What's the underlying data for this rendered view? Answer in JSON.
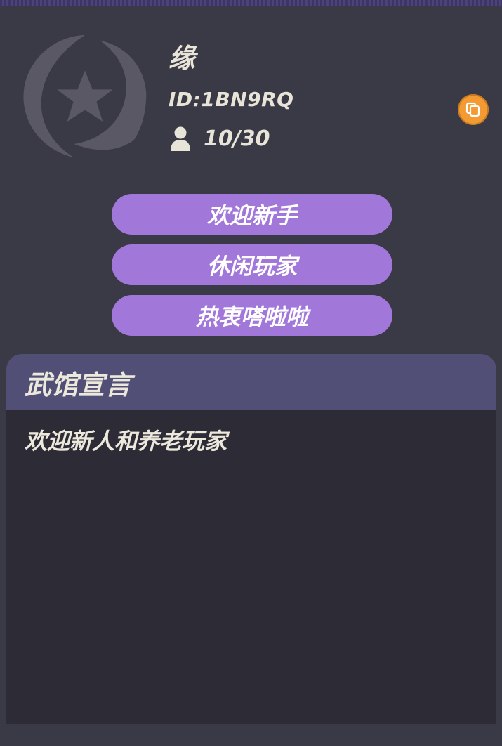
{
  "guild": {
    "name": "缘",
    "id_text": "ID:1BN9RQ",
    "members": "10/30"
  },
  "tags": [
    "欢迎新手",
    "休闲玩家",
    "热衷嗒啦啦"
  ],
  "manifesto": {
    "title": "武馆宣言",
    "text": "欢迎新人和养老玩家"
  },
  "icons": {
    "emblem": "guild-emblem-star-swirl",
    "members": "person-icon",
    "copy": "copy-icon"
  },
  "colors": {
    "background": "#3a3946",
    "tag": "#a177d9",
    "copy_button": "#f39a32",
    "manifesto_header": "#524f77",
    "manifesto_body": "#2d2b36"
  }
}
